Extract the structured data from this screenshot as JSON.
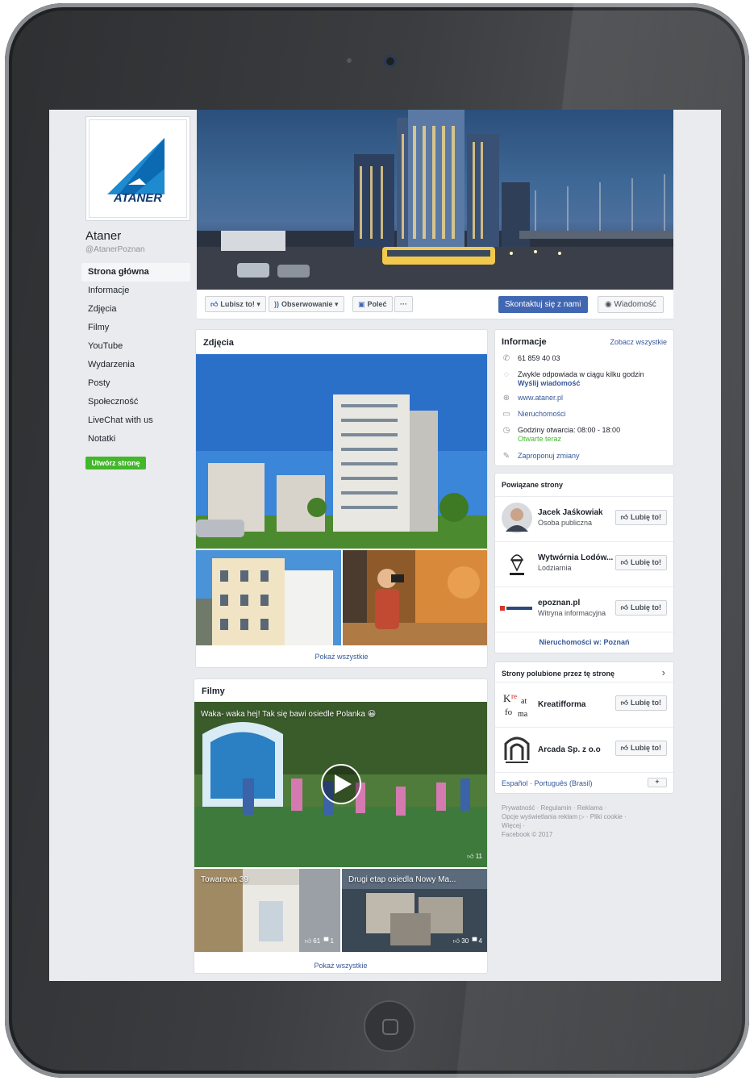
{
  "page": {
    "name": "Ataner",
    "handle": "@AtanerPoznan",
    "logo_text": "ATANER"
  },
  "sidebar": {
    "items": [
      {
        "label": "Strona główna",
        "active": true
      },
      {
        "label": "Informacje"
      },
      {
        "label": "Zdjęcia"
      },
      {
        "label": "Filmy"
      },
      {
        "label": "YouTube"
      },
      {
        "label": "Wydarzenia"
      },
      {
        "label": "Posty"
      },
      {
        "label": "Społeczność"
      },
      {
        "label": "LiveChat with us"
      },
      {
        "label": "Notatki"
      }
    ],
    "create_page_label": "Utwórz stronę"
  },
  "actions": {
    "like_label": "Lubisz to!",
    "follow_label": "Obserwowanie",
    "share_label": "Poleć",
    "more_label": "···",
    "contact_label": "Skontaktuj się z nami",
    "message_label": "Wiadomość"
  },
  "photos": {
    "title": "Zdjęcia",
    "show_all": "Pokaż wszystkie"
  },
  "videos": {
    "title": "Filmy",
    "main_title": "Waka- waka hej! Tak się bawi osiedle Polanka 😀",
    "main_likes": "11",
    "thumbs": [
      {
        "title": "Towarowa 39",
        "likes": "61",
        "comments": "1"
      },
      {
        "title": "Drugi etap osiedla Nowy Ma...",
        "likes": "30",
        "comments": "4"
      }
    ],
    "show_all": "Pokaż wszystkie"
  },
  "info": {
    "title": "Informacje",
    "see_all": "Zobacz wszystkie",
    "phone": "61 859 40 03",
    "response": "Zwykle odpowiada w ciągu kilku godzin",
    "send_message": "Wyślij wiadomość",
    "website": "www.ataner.pl",
    "category": "Nieruchomości",
    "hours": "Godziny otwarcia: 08:00 - 18:00",
    "open_now": "Otwarte teraz",
    "suggest": "Zaproponuj zmiany"
  },
  "related": {
    "title": "Powiązane strony",
    "like_label": "Lubię to!",
    "items": [
      {
        "name": "Jacek Jaśkowiak",
        "sub": "Osoba publiczna"
      },
      {
        "name": "Wytwórnia Lodów...",
        "sub": "Lodziarnia"
      },
      {
        "name": "epoznan.pl",
        "sub": "Witryna informacyjna"
      }
    ],
    "footer_link": "Nieruchomości w: Poznań"
  },
  "liked": {
    "title": "Strony polubione przez tę stronę",
    "like_label": "Lubię to!",
    "items": [
      {
        "name": "Kreatifforma"
      },
      {
        "name": "Arcada Sp. z o.o"
      }
    ]
  },
  "languages": "Español · Português (Brasil)",
  "footer": {
    "line1": "Prywatność · Regulamin · Reklama ·",
    "line2": "Opcje wyświetlania reklam ▷ · Pliki cookie ·",
    "line3": "Więcej ·",
    "line4": "Facebook © 2017"
  },
  "colors": {
    "facebook_blue": "#4267b2",
    "link_blue": "#365899",
    "green": "#42b72a",
    "background": "#e9ebee"
  }
}
